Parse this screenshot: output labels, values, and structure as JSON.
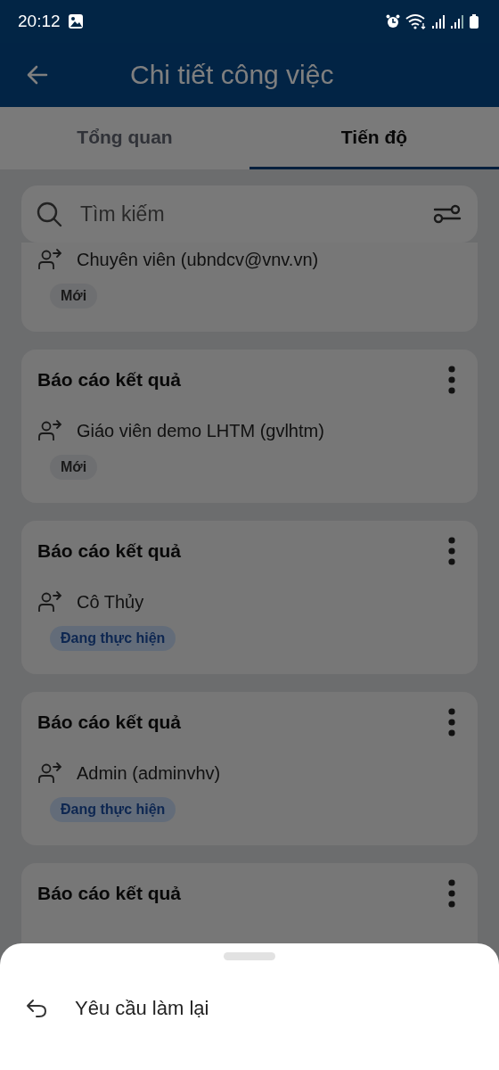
{
  "status_bar": {
    "time": "20:12"
  },
  "app_bar": {
    "title": "Chi tiết công việc"
  },
  "tabs": [
    {
      "label": "Tổng quan",
      "selected": false
    },
    {
      "label": "Tiến độ",
      "selected": true
    }
  ],
  "search": {
    "placeholder": "Tìm kiếm"
  },
  "tasks": [
    {
      "assignee": "Chuyên viên (ubndcv@vnv.vn)",
      "status": {
        "label": "Mới",
        "kind": "new"
      }
    },
    {
      "title": "Báo cáo kết quả",
      "assignee": "Giáo viên demo LHTM (gvlhtm)",
      "status": {
        "label": "Mới",
        "kind": "new"
      }
    },
    {
      "title": "Báo cáo kết quả",
      "assignee": "Cô Thủy",
      "status": {
        "label": "Đang thực hiện",
        "kind": "in_progress"
      }
    },
    {
      "title": "Báo cáo kết quả",
      "assignee": "Admin (adminvhv)",
      "status": {
        "label": "Đang thực hiện",
        "kind": "in_progress"
      }
    },
    {
      "title": "Báo cáo kết quả"
    }
  ],
  "bottom_sheet": {
    "actions": [
      {
        "label": "Yêu cầu làm lại"
      }
    ]
  }
}
